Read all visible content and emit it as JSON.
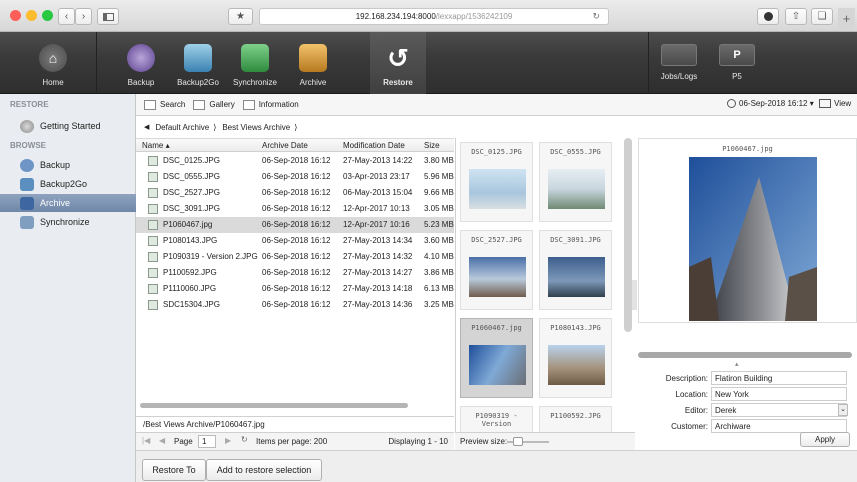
{
  "browser": {
    "url_host": "192.168.234.194:8000",
    "url_path": "/lexxapp/1536242109",
    "colors": {
      "close": "#fc5f57",
      "minimize": "#fdbb2e",
      "zoom": "#28c840"
    }
  },
  "toolbar": {
    "items": [
      {
        "label": "Home",
        "icon": "home-icon"
      },
      {
        "label": "Backup",
        "icon": "backup-icon"
      },
      {
        "label": "Backup2Go",
        "icon": "backup2go-icon"
      },
      {
        "label": "Synchronize",
        "icon": "synchronize-icon"
      },
      {
        "label": "Archive",
        "icon": "archive-icon"
      },
      {
        "label": "Restore",
        "icon": "restore-icon"
      }
    ],
    "right_items": [
      {
        "label": "Jobs/Logs",
        "icon": "jobs-logs-icon"
      },
      {
        "label": "P5",
        "icon": "p5-icon"
      }
    ]
  },
  "sidebar": {
    "restore_header": "RESTORE",
    "browse_header": "BROWSE",
    "items": [
      {
        "label": "Getting Started"
      },
      {
        "label": "Backup"
      },
      {
        "label": "Backup2Go"
      },
      {
        "label": "Archive"
      },
      {
        "label": "Synchronize"
      }
    ]
  },
  "tabs": {
    "search": "Search",
    "gallery": "Gallery",
    "information": "Information",
    "date": "06-Sep-2018 16:12 ▾",
    "view": "View"
  },
  "breadcrumb": {
    "back": "◀",
    "first": "Default Archive",
    "sep1": "⟩",
    "second": "Best Views Archive",
    "sep2": "⟩"
  },
  "table": {
    "headers": {
      "name": "Name ▴",
      "archive_date": "Archive Date",
      "mod_date": "Modification Date",
      "size": "Size"
    },
    "rows": [
      {
        "name": "DSC_0125.JPG",
        "archive": "06-Sep-2018 16:12",
        "mod": "27-May-2013 14:22",
        "size": "3.80 MB"
      },
      {
        "name": "DSC_0555.JPG",
        "archive": "06-Sep-2018 16:12",
        "mod": "03-Apr-2013 23:17",
        "size": "5.96 MB"
      },
      {
        "name": "DSC_2527.JPG",
        "archive": "06-Sep-2018 16:12",
        "mod": "06-May-2013 15:04",
        "size": "9.66 MB"
      },
      {
        "name": "DSC_3091.JPG",
        "archive": "06-Sep-2018 16:12",
        "mod": "12-Apr-2017 10:13",
        "size": "3.05 MB"
      },
      {
        "name": "P1060467.jpg",
        "archive": "06-Sep-2018 16:12",
        "mod": "12-Apr-2017 10:16",
        "size": "5.23 MB"
      },
      {
        "name": "P1080143.JPG",
        "archive": "06-Sep-2018 16:12",
        "mod": "27-May-2013 14:34",
        "size": "3.60 MB"
      },
      {
        "name": "P1090319 - Version 2.JPG",
        "archive": "06-Sep-2018 16:12",
        "mod": "27-May-2013 14:32",
        "size": "4.10 MB"
      },
      {
        "name": "P1100592.JPG",
        "archive": "06-Sep-2018 16:12",
        "mod": "27-May-2013 14:27",
        "size": "3.86 MB"
      },
      {
        "name": "P1110060.JPG",
        "archive": "06-Sep-2018 16:12",
        "mod": "27-May-2013 14:18",
        "size": "6.13 MB"
      },
      {
        "name": "SDC15304.JPG",
        "archive": "06-Sep-2018 16:12",
        "mod": "27-May-2013 14:36",
        "size": "3.25 MB"
      }
    ],
    "selected_row": "P1060467.jpg"
  },
  "path_line": "/Best Views Archive/P1060467.jpg",
  "pager": {
    "page_label": "Page",
    "page_value": "1",
    "items_per_page": "Items per page: 200",
    "displaying": "Displaying 1 - 10"
  },
  "gallery": {
    "cards": [
      {
        "caption": "DSC_0125.JPG"
      },
      {
        "caption": "DSC_0555.JPG"
      },
      {
        "caption": "DSC_2527.JPG"
      },
      {
        "caption": "DSC_3091.JPG"
      },
      {
        "caption": "P1060467.jpg"
      },
      {
        "caption": "P1080143.JPG"
      },
      {
        "caption": "P1090319 - Version"
      },
      {
        "caption": "P1100592.JPG"
      }
    ],
    "preview_size_label": "Preview size:"
  },
  "preview": {
    "title": "P1060467.jpg"
  },
  "metadata": {
    "description_label": "Description:",
    "description_value": "Flatiron Building",
    "location_label": "Location:",
    "location_value": "New York",
    "editor_label": "Editor:",
    "editor_value": "Derek",
    "customer_label": "Customer:",
    "customer_value": "Archiware",
    "apply": "Apply"
  },
  "buttons": {
    "restore_to": "Restore To",
    "add_to_selection": "Add to restore selection"
  }
}
